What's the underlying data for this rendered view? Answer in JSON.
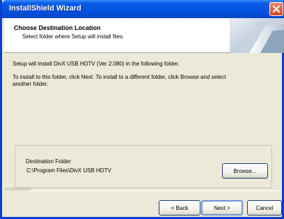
{
  "window": {
    "title": "InstallShield Wizard"
  },
  "header": {
    "title": "Choose Destination Location",
    "subtitle": "Select folder where Setup will install files."
  },
  "body": {
    "line1": "Setup will install DivX USB HDTV (Ver 2.080) in the following folder.",
    "line2": "To install to this folder, click Next. To install to a different folder, click Browse and select",
    "line3": "another folder."
  },
  "destination": {
    "legend": "Destination Folder",
    "path": "C:\\Program Files\\DivX USB HDTV",
    "browse_label": "Browse..."
  },
  "footer": {
    "brand": "InstallShield",
    "back_label": "< Back",
    "next_label": "Next >",
    "cancel_label": "Cancel"
  },
  "colors": {
    "titlebar": "#0453e0",
    "face": "#ece9d8",
    "close": "#d3441f"
  },
  "icons": {
    "close": "close-icon",
    "header_graphic": "install-graphic-icon"
  }
}
